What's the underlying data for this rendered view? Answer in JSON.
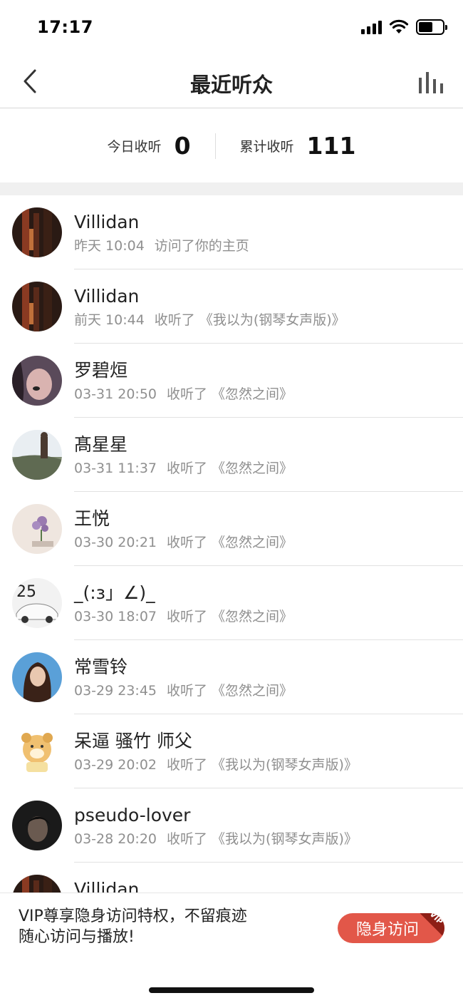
{
  "status_bar": {
    "time": "17:17",
    "icons": [
      "signal-icon",
      "wifi-icon",
      "battery-icon"
    ],
    "battery_level": 0.6
  },
  "nav": {
    "title": "最近听众",
    "back_icon": "chevron-left-icon",
    "right_icon": "bar-chart-icon"
  },
  "stats": {
    "today_label": "今日收听",
    "today_value": "0",
    "total_label": "累计收听",
    "total_value": "111"
  },
  "listeners": [
    {
      "name": "Villidan",
      "time": "昨天 10:04",
      "action": "访问了你的主页"
    },
    {
      "name": "Villidan",
      "time": "前天 10:44",
      "action": "收听了 《我以为(钢琴女声版)》"
    },
    {
      "name": "罗碧烜",
      "time": "03-31 20:50",
      "action": "收听了 《忽然之间》"
    },
    {
      "name": "髙星星",
      "time": "03-31 11:37",
      "action": "收听了 《忽然之间》"
    },
    {
      "name": "王悦",
      "time": "03-30 20:21",
      "action": "收听了 《忽然之间》"
    },
    {
      "name": "_(:з」∠)_",
      "time": "03-30 18:07",
      "action": "收听了 《忽然之间》"
    },
    {
      "name": "常雪铃",
      "time": "03-29 23:45",
      "action": "收听了 《忽然之间》"
    },
    {
      "name": "呆逼 骚竹 师父",
      "time": "03-29 20:02",
      "action": "收听了 《我以为(钢琴女声版)》"
    },
    {
      "name": "pseudo-lover",
      "time": "03-28 20:20",
      "action": "收听了 《我以为(钢琴女声版)》"
    },
    {
      "name": "Villidan",
      "time": "",
      "action": ""
    }
  ],
  "vip": {
    "text": "VIP尊享隐身访问特权，不留痕迹随心访问与播放!",
    "button_label": "隐身访问",
    "badge": "VIP",
    "accent_color": "#e25749"
  }
}
